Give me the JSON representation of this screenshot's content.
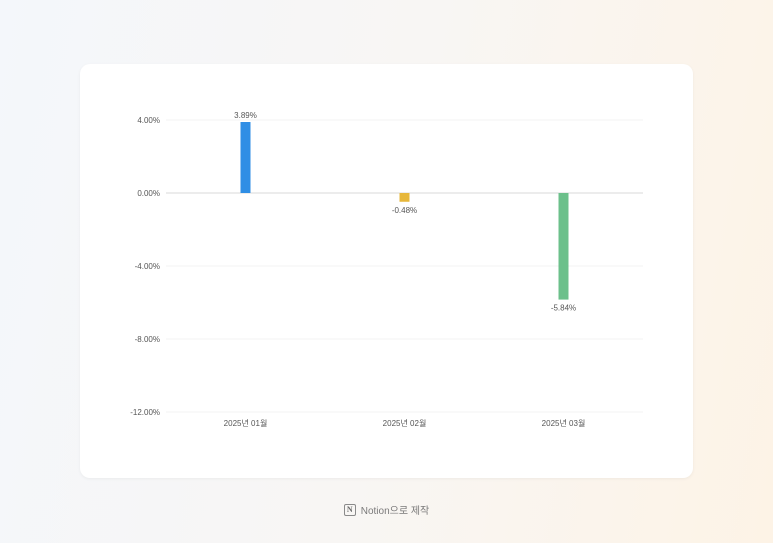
{
  "chart_data": {
    "type": "bar",
    "categories": [
      "2025년 01월",
      "2025년 02월",
      "2025년 03월"
    ],
    "values": [
      3.89,
      -0.48,
      -5.84
    ],
    "data_labels": [
      "3.89%",
      "-0.48%",
      "-5.84%"
    ],
    "colors": [
      "#2f8ee5",
      "#e7b73a",
      "#6cc08b"
    ],
    "yticks": [
      4,
      0,
      -4,
      -8,
      -12
    ],
    "ytick_labels": [
      "4.00%",
      "0.00%",
      "-4.00%",
      "-8.00%",
      "-12.00%"
    ],
    "ylim": [
      -12,
      4
    ],
    "grid": true,
    "title": "",
    "xlabel": "",
    "ylabel": ""
  },
  "footer": {
    "logo_glyph": "N",
    "text": "Notion으로 제작"
  }
}
